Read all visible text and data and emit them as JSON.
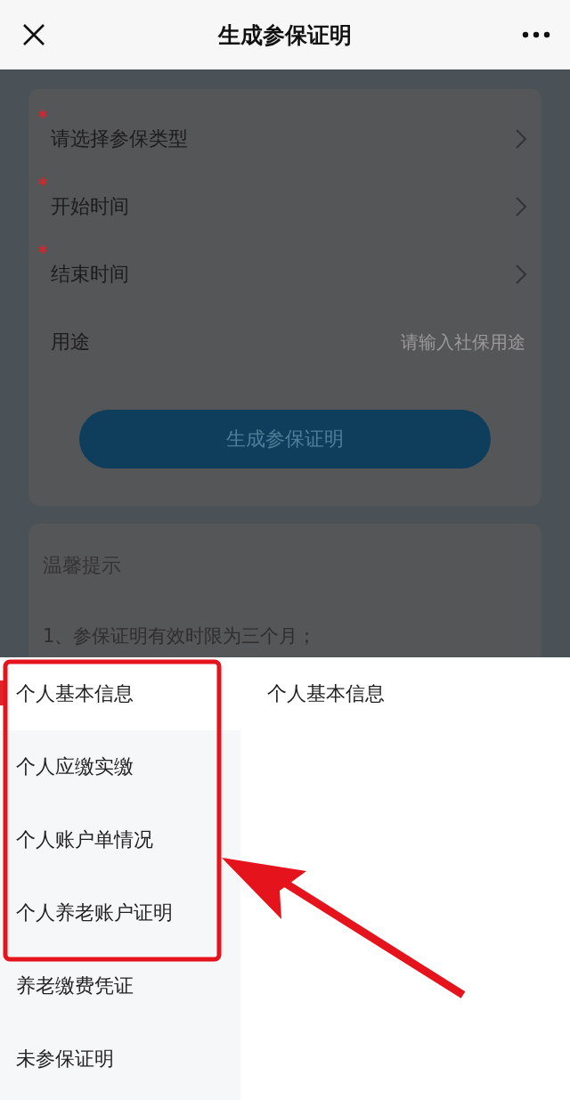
{
  "header": {
    "title": "生成参保证明"
  },
  "form": {
    "fields": [
      {
        "label": "请选择参保类型",
        "required": true,
        "kind": "picker"
      },
      {
        "label": "开始时间",
        "required": true,
        "kind": "picker"
      },
      {
        "label": "结束时间",
        "required": true,
        "kind": "picker"
      },
      {
        "label": "用途",
        "required": false,
        "kind": "input",
        "placeholder": "请输入社保用途"
      }
    ],
    "submit": "生成参保证明"
  },
  "tips": {
    "title": "温馨提示",
    "lines": [
      "1、参保证明有效时限为三个月；"
    ]
  },
  "sheet": {
    "categories": [
      {
        "label": "个人基本信息",
        "selected": true
      },
      {
        "label": "个人应缴实缴",
        "selected": false
      },
      {
        "label": "个人账户单情况",
        "selected": false
      },
      {
        "label": "个人养老账户证明",
        "selected": false
      },
      {
        "label": "养老缴费凭证",
        "selected": false
      },
      {
        "label": "未参保证明",
        "selected": false
      }
    ],
    "options": [
      {
        "label": "个人基本信息"
      }
    ]
  }
}
